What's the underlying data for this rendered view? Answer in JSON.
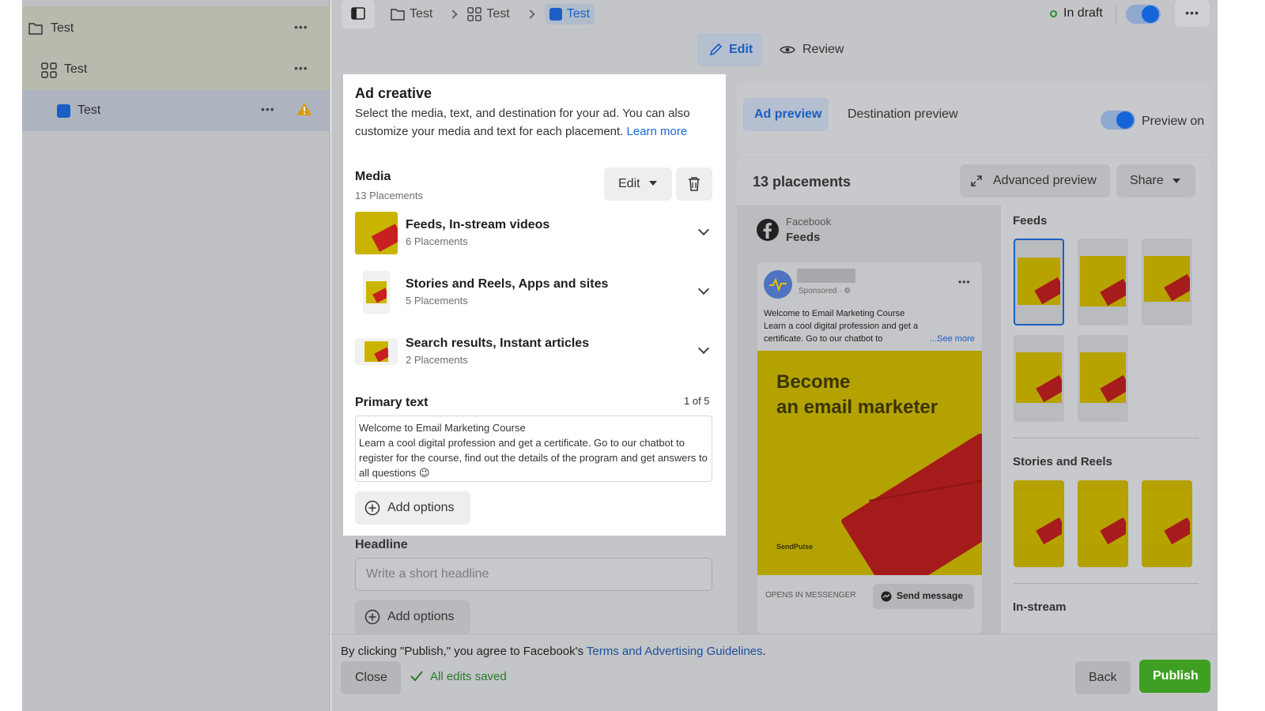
{
  "sidebar": {
    "items": [
      {
        "label": "Test",
        "more": "•••"
      },
      {
        "label": "Test",
        "more": "•••"
      },
      {
        "label": "Test",
        "more": "•••"
      }
    ]
  },
  "topbar": {
    "breadcrumb": [
      "Test",
      "Test",
      "Test"
    ],
    "status": "In draft",
    "more": "•••"
  },
  "tabs": {
    "edit": "Edit",
    "review": "Review"
  },
  "ad_creative": {
    "title": "Ad creative",
    "description": "Select the media, text, and destination for your ad. You can also customize your media and text for each placement. ",
    "learn_more": "Learn more",
    "media_label": "Media",
    "media_sub": "13 Placements",
    "edit_button": "Edit",
    "groups": [
      {
        "title": "Feeds, In-stream videos",
        "sub": "6 Placements"
      },
      {
        "title": "Stories and Reels, Apps and sites",
        "sub": "5 Placements"
      },
      {
        "title": "Search results, Instant articles",
        "sub": "2 Placements"
      }
    ],
    "primary_text_label": "Primary text",
    "primary_text_count": "1 of 5",
    "primary_text_line1": "Welcome to Email Marketing Course",
    "primary_text_line2": "Learn a cool digital profession and get a certificate. Go to our chatbot to register for the course, find out the details of the program and get answers to all questions 😉",
    "add_options": "Add options",
    "headline_label": "Headline",
    "headline_placeholder": "Write a short headline",
    "add_options2": "Add options"
  },
  "preview": {
    "tab_ad": "Ad preview",
    "tab_destination": "Destination preview",
    "toggle_label": "Preview on",
    "placements_title": "13 placements",
    "advanced_preview": "Advanced preview",
    "share": "Share",
    "platform": "Facebook",
    "placement": "Feeds",
    "sponsored": "Sponsored · ⚙",
    "post_line1": "Welcome to Email Marketing Course",
    "post_line2": "Learn a cool digital profession and get a",
    "post_line3": "certificate. Go to our chatbot to",
    "see_more": "...See more",
    "creative_line1": "Become",
    "creative_line2": "an email marketer",
    "brand": "SendPulse",
    "opens_in": "OPENS IN MESSENGER",
    "send_message": "Send message",
    "more": "•••",
    "sections": {
      "feeds": "Feeds",
      "stories": "Stories and Reels",
      "instream": "In-stream"
    }
  },
  "footer": {
    "agreement_prefix": "By clicking \"Publish,\" you agree to Facebook's ",
    "agreement_link": "Terms and Advertising Guidelines",
    "agreement_suffix": ".",
    "close": "Close",
    "saved": "All edits saved",
    "back": "Back",
    "publish": "Publish"
  },
  "colors": {
    "accent": "#1877f2",
    "publish": "#42b72a",
    "warning": "#f0a500",
    "creative_yellow": "#c9b500"
  }
}
